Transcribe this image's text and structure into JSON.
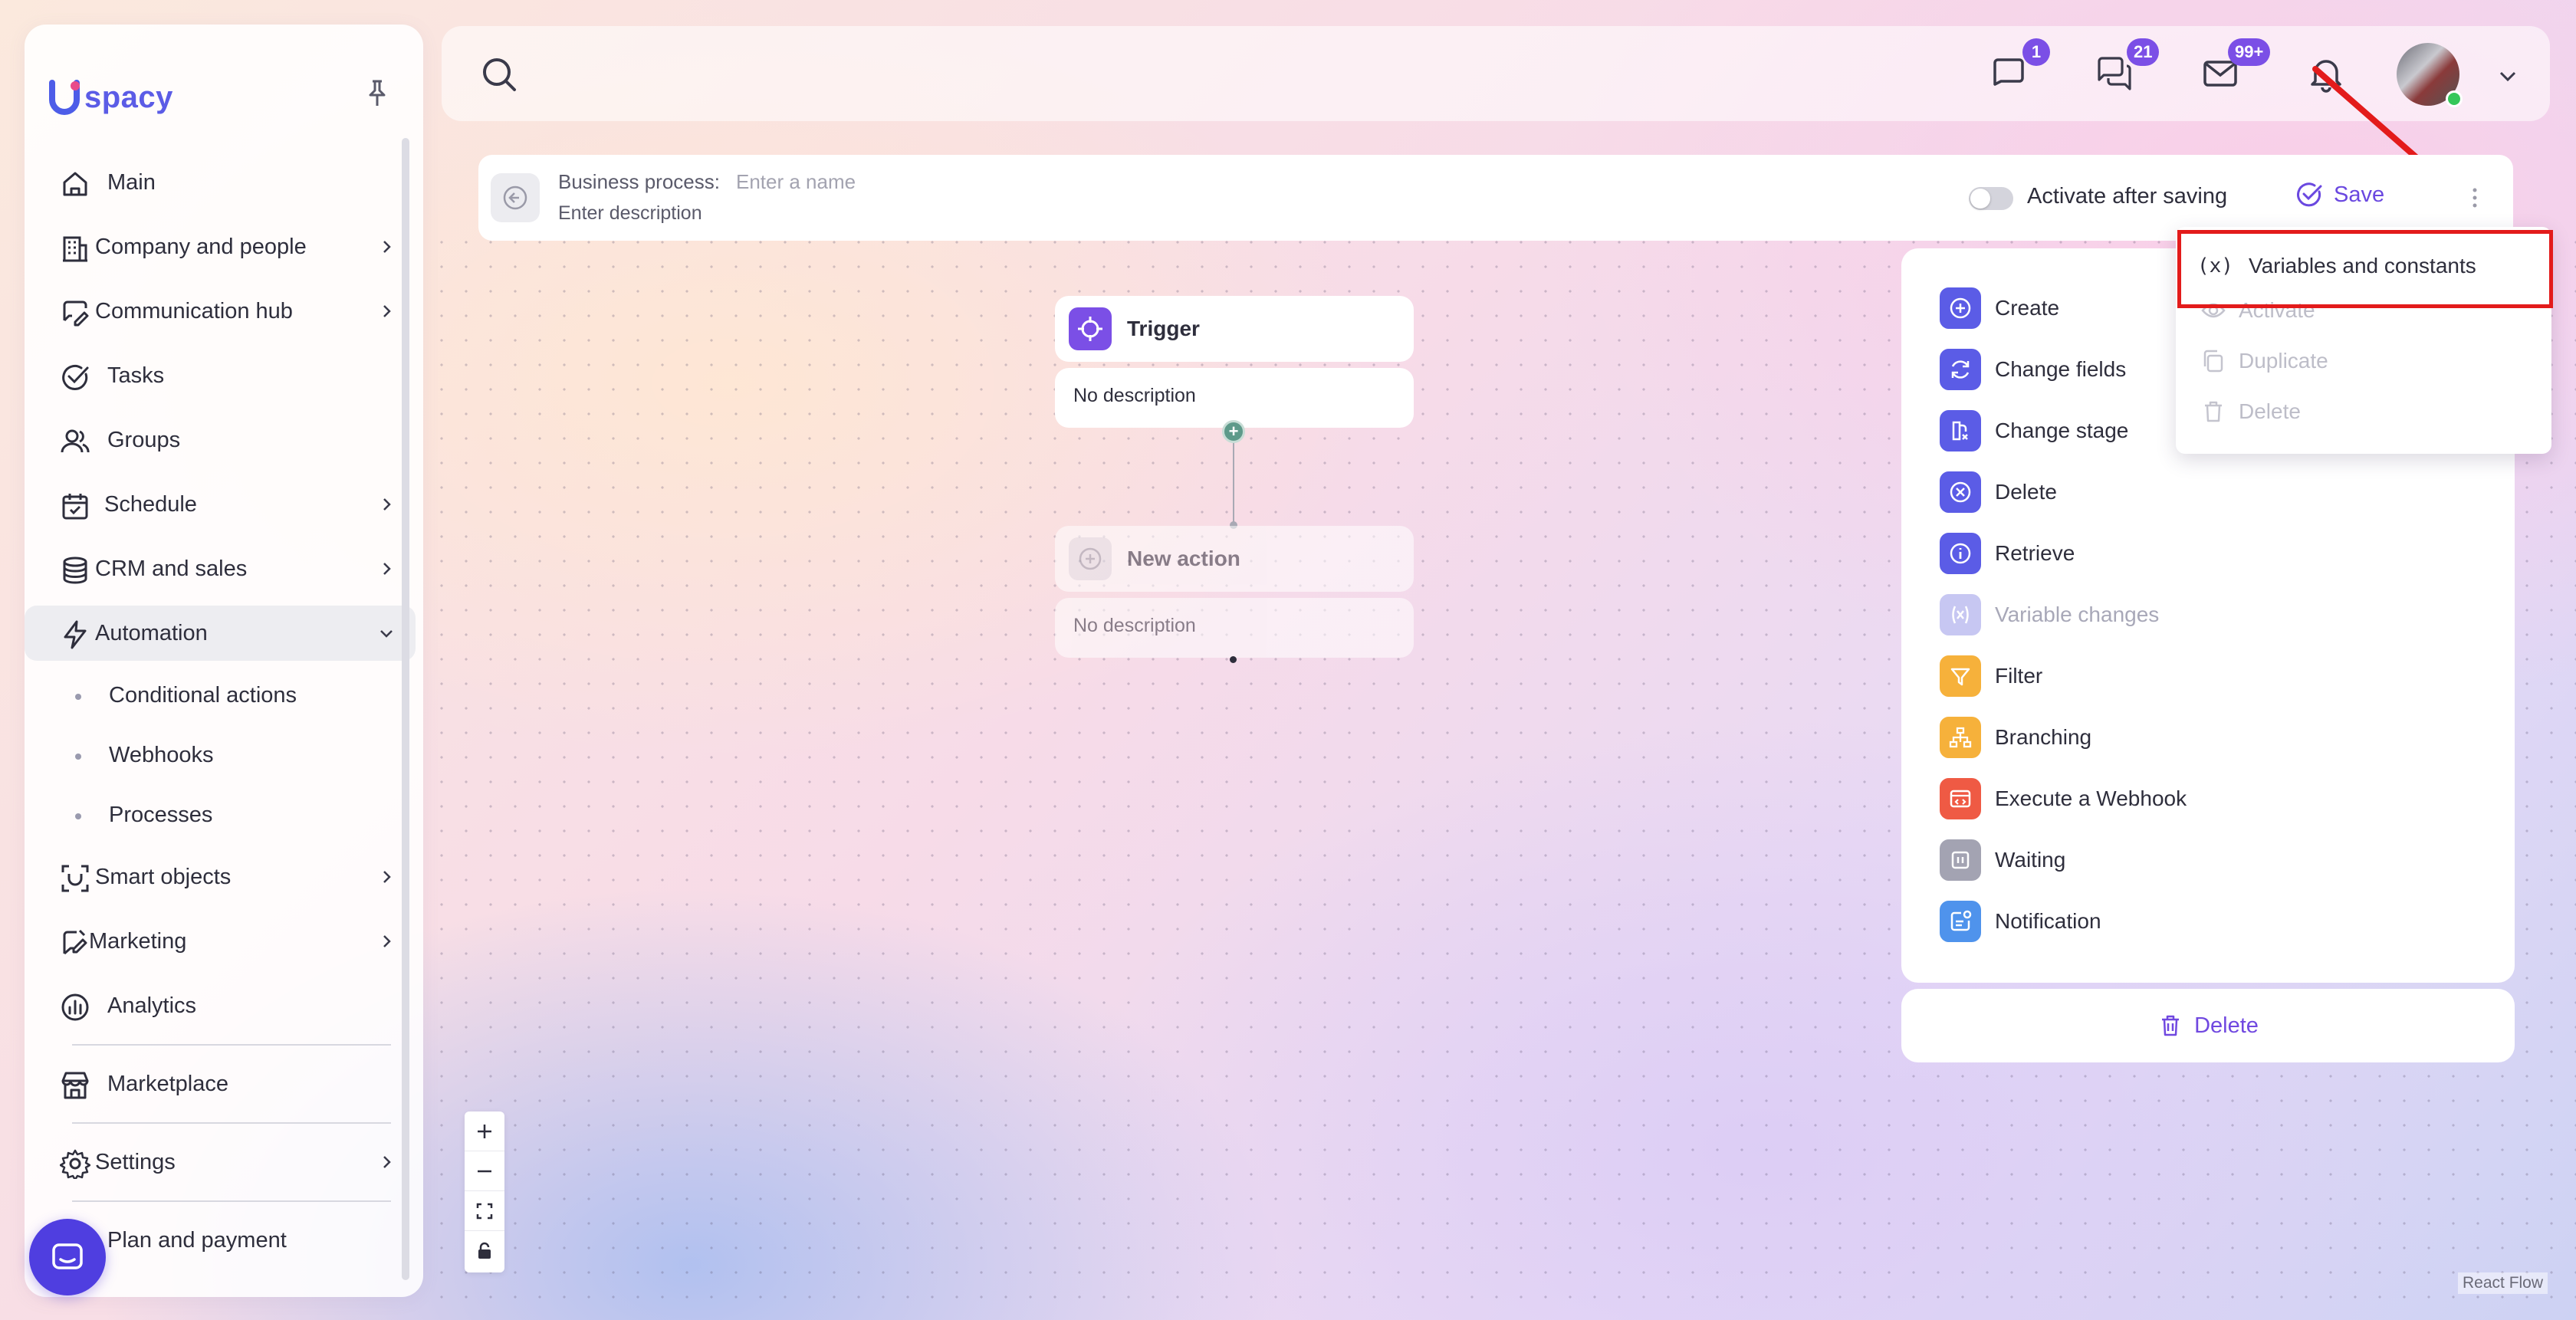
{
  "brand": {
    "logo_text": "spacy",
    "accent": "#5b5ce6"
  },
  "sidebar": {
    "items": [
      {
        "label": "Main",
        "icon": "home-icon"
      },
      {
        "label": "Company and people",
        "icon": "building-icon"
      },
      {
        "label": "Communication hub",
        "icon": "chat-edit-icon"
      },
      {
        "label": "Tasks",
        "icon": "check-circle-icon"
      },
      {
        "label": "Groups",
        "icon": "users-icon"
      },
      {
        "label": "Schedule",
        "icon": "calendar-icon"
      },
      {
        "label": "CRM and sales",
        "icon": "database-icon"
      },
      {
        "label": "Automation",
        "icon": "lightning-icon"
      }
    ],
    "automation_sub": [
      "Conditional actions",
      "Webhooks",
      "Processes"
    ],
    "items2": [
      {
        "label": "Smart objects",
        "icon": "scan-icon"
      },
      {
        "label": "Marketing",
        "icon": "megaphone-icon"
      },
      {
        "label": "Analytics",
        "icon": "chart-icon"
      }
    ],
    "marketplace": "Marketplace",
    "settings": "Settings",
    "plan": "Plan and payment"
  },
  "topbar": {
    "chat_badge": "1",
    "messages_badge": "21",
    "mail_badge": "99+"
  },
  "process": {
    "label": "Business process:",
    "name_placeholder": "Enter a name",
    "description_placeholder": "Enter description",
    "activate_label": "Activate after saving",
    "save_label": "Save"
  },
  "flow": {
    "trigger_title": "Trigger",
    "trigger_desc": "No description",
    "action_title": "New action",
    "action_desc": "No description"
  },
  "actions": [
    {
      "label": "Create",
      "color": "#5b5ce6",
      "disabled": false
    },
    {
      "label": "Change fields",
      "color": "#5b5ce6",
      "disabled": false
    },
    {
      "label": "Change stage",
      "color": "#5b5ce6",
      "disabled": false
    },
    {
      "label": "Delete",
      "color": "#5b5ce6",
      "disabled": false
    },
    {
      "label": "Retrieve",
      "color": "#5b5ce6",
      "disabled": false
    },
    {
      "label": "Variable changes",
      "color": "#b8b8ee",
      "disabled": true
    },
    {
      "label": "Filter",
      "color": "#f6b13b",
      "disabled": false
    },
    {
      "label": "Branching",
      "color": "#f6b13b",
      "disabled": false
    },
    {
      "label": "Execute a Webhook",
      "color": "#ef5a44",
      "disabled": false
    },
    {
      "label": "Waiting",
      "color": "#a3a3b2",
      "disabled": false
    },
    {
      "label": "Notification",
      "color": "#4f93ec",
      "disabled": false
    }
  ],
  "delete_label": "Delete",
  "dropdown": {
    "items": [
      "Variables and constants",
      "Activate",
      "Duplicate",
      "Delete"
    ],
    "highlight_color": "#e31b1b"
  },
  "attribution": "React Flow"
}
